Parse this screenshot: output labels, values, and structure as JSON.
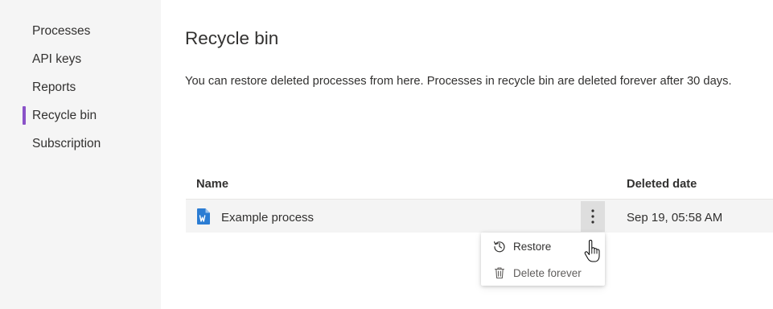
{
  "sidebar": {
    "items": [
      {
        "label": "Processes"
      },
      {
        "label": "API keys"
      },
      {
        "label": "Reports"
      },
      {
        "label": "Recycle bin",
        "active": true
      },
      {
        "label": "Subscription"
      }
    ],
    "active_color": "#8a52c8"
  },
  "main": {
    "title": "Recycle bin",
    "description": "You can restore deleted processes from here. Processes in recycle bin are deleted forever after 30 days.",
    "table": {
      "columns": [
        "Name",
        "Deleted date"
      ],
      "rows": [
        {
          "name": "Example process",
          "deleted_date": "Sep 19, 05:58 AM",
          "icon": "word-document-icon"
        }
      ]
    }
  },
  "context_menu": {
    "items": [
      {
        "label": "Restore",
        "icon": "history-icon"
      },
      {
        "label": "Delete forever",
        "icon": "trash-icon"
      }
    ]
  },
  "colors": {
    "sidebar_bg": "#f5f5f5",
    "doc_icon_blue": "#2b7cd3"
  }
}
